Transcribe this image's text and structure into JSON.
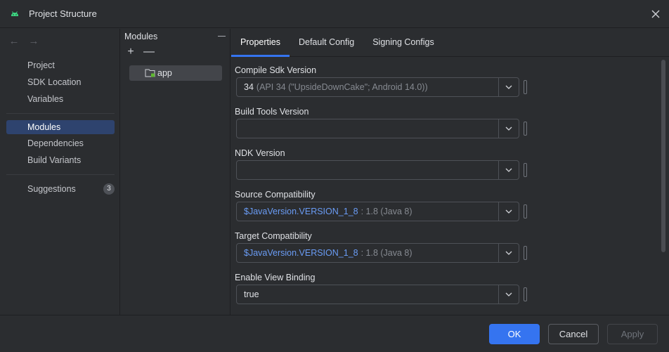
{
  "window": {
    "title": "Project Structure"
  },
  "nav": {
    "back": "←",
    "forward": "→",
    "items_top": [
      "Project",
      "SDK Location",
      "Variables"
    ],
    "items_mid": [
      "Modules",
      "Dependencies",
      "Build Variants"
    ],
    "suggestions_label": "Suggestions",
    "suggestions_count": "3",
    "selected": "Modules"
  },
  "modules": {
    "header": "Modules",
    "add": "+",
    "remove": "—",
    "items": [
      "app"
    ]
  },
  "tabs": [
    "Properties",
    "Default Config",
    "Signing Configs"
  ],
  "active_tab": "Properties",
  "fields": {
    "compile_sdk": {
      "label": "Compile Sdk Version",
      "value": "34",
      "detail": "(API 34 (\"UpsideDownCake\"; Android 14.0))"
    },
    "build_tools": {
      "label": "Build Tools Version",
      "value": ""
    },
    "ndk": {
      "label": "NDK Version",
      "value": ""
    },
    "source_compat": {
      "label": "Source Compatibility",
      "value": "$JavaVersion.VERSION_1_8",
      "detail": ": 1.8 (Java 8)"
    },
    "target_compat": {
      "label": "Target Compatibility",
      "value": "$JavaVersion.VERSION_1_8",
      "detail": ": 1.8 (Java 8)"
    },
    "view_binding": {
      "label": "Enable View Binding",
      "value": "true"
    }
  },
  "footer": {
    "ok": "OK",
    "cancel": "Cancel",
    "apply": "Apply"
  },
  "colors": {
    "accent": "#3574f0",
    "link": "#6a9cf5",
    "android_green": "#3ddc84"
  }
}
